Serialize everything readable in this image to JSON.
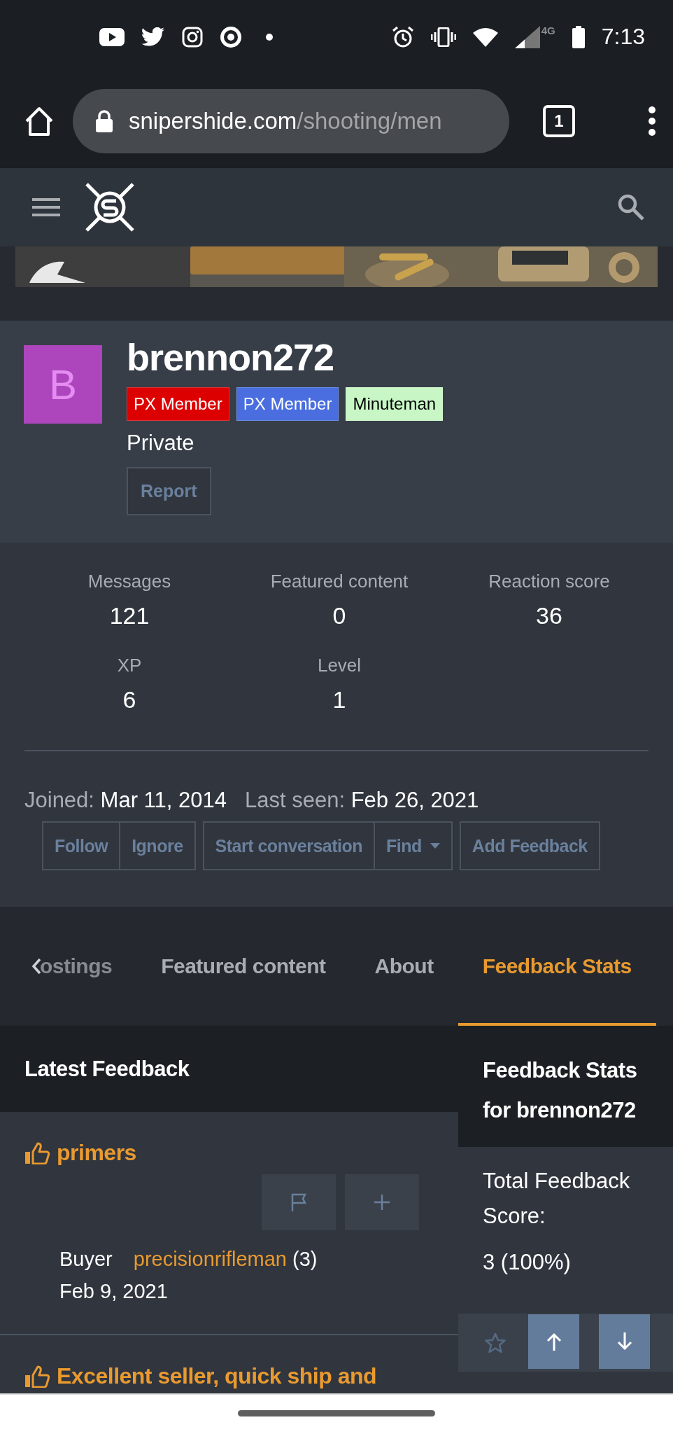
{
  "status_bar": {
    "network": "4G",
    "time": "7:13"
  },
  "browser": {
    "url_host": "snipershide.com",
    "url_path": "/shooting/men",
    "tab_count": "1"
  },
  "profile": {
    "avatar_letter": "B",
    "username": "brennon272",
    "badges": [
      {
        "label": "PX Member",
        "color": "#dd0000"
      },
      {
        "label": "PX Member",
        "color": "#4a6ee0"
      },
      {
        "label": "Minuteman",
        "color": "#c8f7c5"
      }
    ],
    "title": "Private",
    "report_button": "Report"
  },
  "stats": [
    {
      "label": "Messages",
      "value": "121"
    },
    {
      "label": "Featured content",
      "value": "0"
    },
    {
      "label": "Reaction score",
      "value": "36"
    },
    {
      "label": "XP",
      "value": "6"
    },
    {
      "label": "Level",
      "value": "1"
    }
  ],
  "dates": [
    {
      "label": "Joined:",
      "value": "Mar 11, 2014"
    },
    {
      "label": "Last seen:",
      "value": "Feb 26, 2021"
    }
  ],
  "action_groups": [
    [
      {
        "label": "Follow",
        "dropdown": false
      },
      {
        "label": "Ignore",
        "dropdown": false
      }
    ],
    [
      {
        "label": "Start conversation",
        "dropdown": false
      },
      {
        "label": "Find",
        "dropdown": true
      }
    ],
    [
      {
        "label": "Add Feedback",
        "dropdown": false
      }
    ]
  ],
  "tabs": [
    {
      "label": "ostings",
      "selected": false
    },
    {
      "label": "Featured content",
      "selected": false
    },
    {
      "label": "About",
      "selected": false
    },
    {
      "label": "Feedback Stats",
      "selected": true
    }
  ],
  "latest_feedback": {
    "title": "Latest Feedback",
    "items": [
      {
        "title": "primers",
        "role": "Buyer",
        "user": "precisionrifleman",
        "count": "(3)",
        "date": "Feb 9, 2021"
      },
      {
        "title": "Excellent seller, quick ship and"
      }
    ]
  },
  "feedback_stats": {
    "title": "Feedback Stats for brennon272",
    "score_label": "Total Feedback Score:",
    "score": "3 (100%)"
  }
}
